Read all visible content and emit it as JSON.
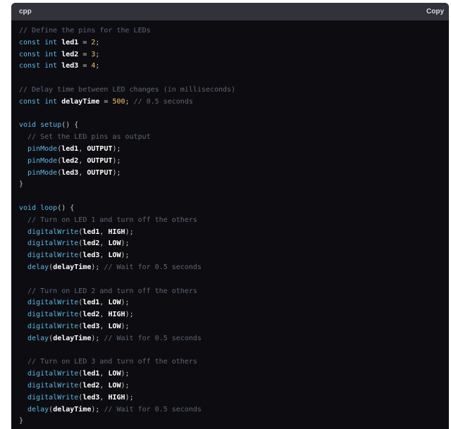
{
  "header": {
    "language": "cpp",
    "copy_label": "Copy"
  },
  "code_lines": [
    [
      [
        "c",
        "// Define the pins for the LEDs"
      ]
    ],
    [
      [
        "k",
        "const int "
      ],
      [
        "v",
        "led1"
      ],
      [
        "p",
        " = "
      ],
      [
        "n",
        "2"
      ],
      [
        "p",
        ";"
      ]
    ],
    [
      [
        "k",
        "const int "
      ],
      [
        "v",
        "led2"
      ],
      [
        "p",
        " = "
      ],
      [
        "n",
        "3"
      ],
      [
        "p",
        ";"
      ]
    ],
    [
      [
        "k",
        "const int "
      ],
      [
        "v",
        "led3"
      ],
      [
        "p",
        " = "
      ],
      [
        "n",
        "4"
      ],
      [
        "p",
        ";"
      ]
    ],
    [],
    [
      [
        "c",
        "// Delay time between LED changes (in milliseconds)"
      ]
    ],
    [
      [
        "k",
        "const int "
      ],
      [
        "v",
        "delayTime"
      ],
      [
        "p",
        " = "
      ],
      [
        "n",
        "500"
      ],
      [
        "p",
        "; "
      ],
      [
        "c",
        "// 0.5 seconds"
      ]
    ],
    [],
    [
      [
        "k",
        "void "
      ],
      [
        "f",
        "setup"
      ],
      [
        "p",
        "() {"
      ]
    ],
    [
      [
        "p",
        "  "
      ],
      [
        "c",
        "// Set the LED pins as output"
      ]
    ],
    [
      [
        "p",
        "  "
      ],
      [
        "f",
        "pinMode"
      ],
      [
        "p",
        "("
      ],
      [
        "v",
        "led1"
      ],
      [
        "p",
        ", "
      ],
      [
        "v",
        "OUTPUT"
      ],
      [
        "p",
        ");"
      ]
    ],
    [
      [
        "p",
        "  "
      ],
      [
        "f",
        "pinMode"
      ],
      [
        "p",
        "("
      ],
      [
        "v",
        "led2"
      ],
      [
        "p",
        ", "
      ],
      [
        "v",
        "OUTPUT"
      ],
      [
        "p",
        ");"
      ]
    ],
    [
      [
        "p",
        "  "
      ],
      [
        "f",
        "pinMode"
      ],
      [
        "p",
        "("
      ],
      [
        "v",
        "led3"
      ],
      [
        "p",
        ", "
      ],
      [
        "v",
        "OUTPUT"
      ],
      [
        "p",
        ");"
      ]
    ],
    [
      [
        "p",
        "}"
      ]
    ],
    [],
    [
      [
        "k",
        "void "
      ],
      [
        "f",
        "loop"
      ],
      [
        "p",
        "() {"
      ]
    ],
    [
      [
        "p",
        "  "
      ],
      [
        "c",
        "// Turn on LED 1 and turn off the others"
      ]
    ],
    [
      [
        "p",
        "  "
      ],
      [
        "f",
        "digitalWrite"
      ],
      [
        "p",
        "("
      ],
      [
        "v",
        "led1"
      ],
      [
        "p",
        ", "
      ],
      [
        "v",
        "HIGH"
      ],
      [
        "p",
        ");"
      ]
    ],
    [
      [
        "p",
        "  "
      ],
      [
        "f",
        "digitalWrite"
      ],
      [
        "p",
        "("
      ],
      [
        "v",
        "led2"
      ],
      [
        "p",
        ", "
      ],
      [
        "v",
        "LOW"
      ],
      [
        "p",
        ");"
      ]
    ],
    [
      [
        "p",
        "  "
      ],
      [
        "f",
        "digitalWrite"
      ],
      [
        "p",
        "("
      ],
      [
        "v",
        "led3"
      ],
      [
        "p",
        ", "
      ],
      [
        "v",
        "LOW"
      ],
      [
        "p",
        ");"
      ]
    ],
    [
      [
        "p",
        "  "
      ],
      [
        "f",
        "delay"
      ],
      [
        "p",
        "("
      ],
      [
        "v",
        "delayTime"
      ],
      [
        "p",
        "); "
      ],
      [
        "c",
        "// Wait for 0.5 seconds"
      ]
    ],
    [],
    [
      [
        "p",
        "  "
      ],
      [
        "c",
        "// Turn on LED 2 and turn off the others"
      ]
    ],
    [
      [
        "p",
        "  "
      ],
      [
        "f",
        "digitalWrite"
      ],
      [
        "p",
        "("
      ],
      [
        "v",
        "led1"
      ],
      [
        "p",
        ", "
      ],
      [
        "v",
        "LOW"
      ],
      [
        "p",
        ");"
      ]
    ],
    [
      [
        "p",
        "  "
      ],
      [
        "f",
        "digitalWrite"
      ],
      [
        "p",
        "("
      ],
      [
        "v",
        "led2"
      ],
      [
        "p",
        ", "
      ],
      [
        "v",
        "HIGH"
      ],
      [
        "p",
        ");"
      ]
    ],
    [
      [
        "p",
        "  "
      ],
      [
        "f",
        "digitalWrite"
      ],
      [
        "p",
        "("
      ],
      [
        "v",
        "led3"
      ],
      [
        "p",
        ", "
      ],
      [
        "v",
        "LOW"
      ],
      [
        "p",
        ");"
      ]
    ],
    [
      [
        "p",
        "  "
      ],
      [
        "f",
        "delay"
      ],
      [
        "p",
        "("
      ],
      [
        "v",
        "delayTime"
      ],
      [
        "p",
        "); "
      ],
      [
        "c",
        "// Wait for 0.5 seconds"
      ]
    ],
    [],
    [
      [
        "p",
        "  "
      ],
      [
        "c",
        "// Turn on LED 3 and turn off the others"
      ]
    ],
    [
      [
        "p",
        "  "
      ],
      [
        "f",
        "digitalWrite"
      ],
      [
        "p",
        "("
      ],
      [
        "v",
        "led1"
      ],
      [
        "p",
        ", "
      ],
      [
        "v",
        "LOW"
      ],
      [
        "p",
        ");"
      ]
    ],
    [
      [
        "p",
        "  "
      ],
      [
        "f",
        "digitalWrite"
      ],
      [
        "p",
        "("
      ],
      [
        "v",
        "led2"
      ],
      [
        "p",
        ", "
      ],
      [
        "v",
        "LOW"
      ],
      [
        "p",
        ");"
      ]
    ],
    [
      [
        "p",
        "  "
      ],
      [
        "f",
        "digitalWrite"
      ],
      [
        "p",
        "("
      ],
      [
        "v",
        "led3"
      ],
      [
        "p",
        ", "
      ],
      [
        "v",
        "HIGH"
      ],
      [
        "p",
        ");"
      ]
    ],
    [
      [
        "p",
        "  "
      ],
      [
        "f",
        "delay"
      ],
      [
        "p",
        "("
      ],
      [
        "v",
        "delayTime"
      ],
      [
        "p",
        "); "
      ],
      [
        "c",
        "// Wait for 0.5 seconds"
      ]
    ],
    [
      [
        "p",
        "}"
      ]
    ]
  ],
  "colors": {
    "background": "#0d0d11",
    "header": "#32323b",
    "comment": "#5e6675",
    "keyword": "#5eb7e6",
    "identifier": "#ffffff",
    "number": "#f5c26b"
  }
}
